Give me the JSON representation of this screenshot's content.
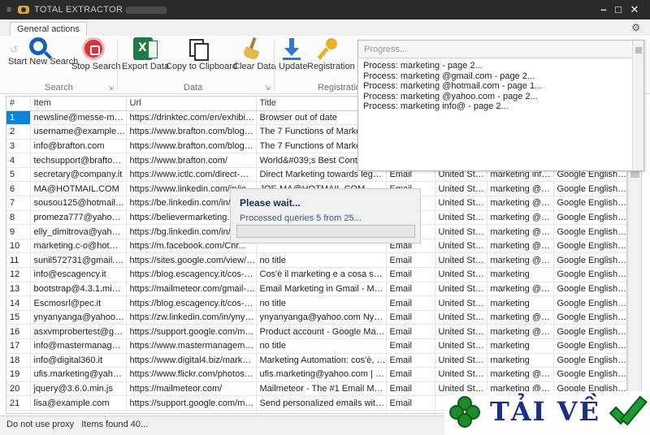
{
  "window": {
    "title": "TOTAL EXTRACTOR"
  },
  "tabs": [
    {
      "label": "General actions"
    }
  ],
  "ribbon": {
    "search_group": {
      "label": "Search",
      "buttons": [
        {
          "label": "Start New Search"
        },
        {
          "label": "Stop Search"
        }
      ]
    },
    "data_group": {
      "label": "Data",
      "buttons": [
        {
          "label": "Export Data"
        },
        {
          "label": "Copy to Clipboard"
        },
        {
          "label": "Clear Data"
        }
      ]
    },
    "registration_group": {
      "label": "Registration",
      "buttons": [
        {
          "label": "Update"
        },
        {
          "label": "Registration"
        }
      ]
    }
  },
  "progress": {
    "placeholder": "Progress...",
    "lines": [
      "Process: marketing - page 2...",
      "Process: marketing @gmail.com - page 2...",
      "Process: marketing @hotmail.com - page 1...",
      "Process: marketing @yahoo.com - page 2...",
      "Process: marketing info@ - page 2..."
    ]
  },
  "wait_dialog": {
    "title": "Please wait...",
    "status": "Processed queries 5 from 25...",
    "progress_fraction": 0.0
  },
  "grid": {
    "columns": [
      "#",
      "Item",
      "Url",
      "Title"
    ],
    "rows": [
      [
        "1",
        "newsline@messe-muenche...",
        "https://drinktec.com/en/exhibitors/sta...",
        "Browser out of date",
        "",
        "",
        "",
        ""
      ],
      [
        "2",
        "username@example.com",
        "https://www.brafton.com/blog/conten...",
        "The 7 Functions of Marketing",
        "",
        "",
        "",
        ""
      ],
      [
        "3",
        "info@brafton.com",
        "https://www.brafton.com/blog/conten...",
        "The 7 Functions of Marketing",
        "",
        "",
        "",
        ""
      ],
      [
        "4",
        "techsupport@brafton.com",
        "https://www.brafton.com/",
        "World&#039;s Best Content M",
        "",
        "",
        "",
        ""
      ],
      [
        "5",
        "secretary@company.it",
        "https://www.ictlc.com/direct-marketin...",
        "Direct Marketing towards legal persons",
        "Email",
        "United States",
        "marketing info@",
        "Google English. ..."
      ],
      [
        "6",
        "MA@HOTMAIL.COM",
        "https://www.linkedin.com/in/joe-ma-h...",
        "JOE MA@HOTMAIL.COM - MARKETI...",
        "Email",
        "United States",
        "marketing @hotm...",
        "Google English. ..."
      ],
      [
        "7",
        "sousou125@hotmail.com",
        "https://be.linkedin.com/in/so...",
        "",
        "Email",
        "United States",
        "marketing @hotm...",
        "Google English. ..."
      ],
      [
        "8",
        "promeza777@yahoo.com",
        "https://believermarketing.com/...",
        "",
        "Email",
        "United States",
        "marketing @yahoo...",
        "Google English. ..."
      ],
      [
        "9",
        "elly_dimitrova@yahoo.com",
        "https://bg.linkedin.com/in/ell...",
        "",
        "Email",
        "United States",
        "marketing @yahoo...",
        "Google English. ..."
      ],
      [
        "10",
        "marketing.c-o@hotmail.com",
        "https://m.facebook.com/Chr...",
        "",
        "Email",
        "United States",
        "marketing @hotm...",
        "Google English. ..."
      ],
      [
        "11",
        "sunil572731@gmail.com",
        "https://sites.google.com/view/saimark...",
        "no title",
        "Email",
        "United States",
        "marketing @gmai...",
        "Google English. ..."
      ],
      [
        "12",
        "info@escagency.it",
        "https://blog.escagency.it/cos-e-il-mark...",
        "Cos'è il marketing e a cosa serve?",
        "Email",
        "United States",
        "marketing",
        "Google English. ..."
      ],
      [
        "13",
        "bootstrap@4.3.1.min.css",
        "https://mailmeteor.com/gmail-marketing",
        "Email Marketing in Gmail - Mailmeteor",
        "Email",
        "United States",
        "marketing @gmai...",
        "Google English. ..."
      ],
      [
        "14",
        "Escmosrl@pec.it",
        "https://blog.escagency.it/cos-e-il-mark...",
        "no title",
        "Email",
        "United States",
        "marketing",
        "Google English. ..."
      ],
      [
        "15",
        "ynyanyanga@yahoo.com",
        "https://zw.linkedin.com/in/ynyanyang...",
        "ynyanyanga@yahoo.com Nyanyanga -...",
        "Email",
        "United States",
        "marketing @yahoo...",
        "Google English. ..."
      ],
      [
        "16",
        "asxvmprobertest@gmail.com",
        "https://support.google.com/marketing...",
        "Product account - Google Marketing P...",
        "Email",
        "United States",
        "marketing @gmai...",
        "Google English. ..."
      ],
      [
        "17",
        "info@mastermanagement.it",
        "https://www.mastermanagement.it/ma...",
        "no title",
        "Email",
        "United States",
        "marketing",
        "Google English. ..."
      ],
      [
        "18",
        "info@digital360.it",
        "https://www.digital4.biz/marketing/ma...",
        "Marketing Automation: cos'è, come fu...",
        "Email",
        "United States",
        "marketing",
        "Google English. ..."
      ],
      [
        "19",
        "ufis.marketing@yahoo.com",
        "https://www.flickr.com/photos/96661...",
        "ufis.marketing@yahoo.com | Flickr - sni...",
        "Email",
        "United States",
        "marketing @yahoo...",
        "Google English. ..."
      ],
      [
        "20",
        "jquery@3.6.0.min.js",
        "https://mailmeteor.com/",
        "Mailmeteor - The #1 Email Marketing P...",
        "Email",
        "United States",
        "marketing @gmai...",
        "Google English. ..."
      ],
      [
        "21",
        "lisa@example.com",
        "https://support.google.com/mail/answ...",
        "Send personalized emails with mail mer...",
        "Email",
        "",
        "",
        ""
      ],
      [
        "22",
        "...",
        "",
        "",
        "",
        "",
        "",
        ""
      ]
    ]
  },
  "status": {
    "proxy": "Do not use proxy",
    "items": "Items found 40..."
  },
  "watermark": {
    "text": "TẢI VỀ"
  },
  "colors": {
    "selection": "#0a84d8",
    "progress_fill": "#06b025",
    "titlebar": "#2b2b2b",
    "watermark_text": "#1a2f8a"
  }
}
